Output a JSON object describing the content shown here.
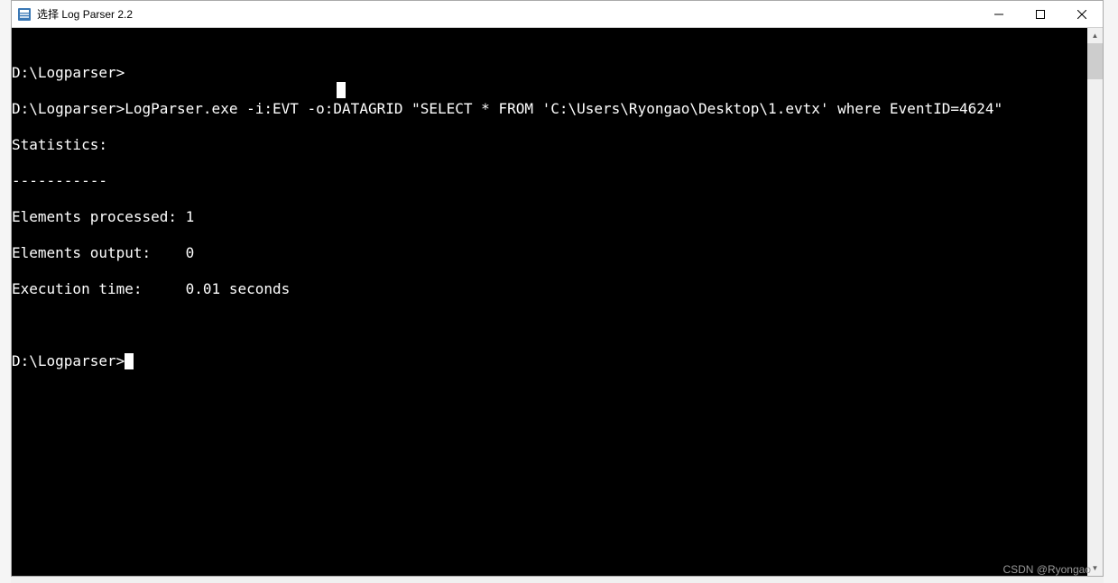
{
  "window": {
    "title": "选择 Log Parser 2.2"
  },
  "terminal": {
    "lines": [
      "",
      "D:\\Logparser>",
      "D:\\Logparser>LogParser.exe -i:EVT -o:DATAGRID \"SELECT * FROM 'C:\\Users\\Ryongao\\Desktop\\1.evtx' where EventID=4624\"",
      "",
      "Statistics:",
      "-----------",
      "Elements processed: 1",
      "Elements output:    0",
      "Execution time:     0.01 seconds",
      "",
      "",
      "D:\\Logparser>"
    ],
    "prompt": "D:\\Logparser>",
    "command": "LogParser.exe -i:EVT -o:DATAGRID \"SELECT * FROM 'C:\\Users\\Ryongao\\Desktop\\1.evtx' where EventID=4624\"",
    "stats": {
      "header": "Statistics:",
      "separator": "-----------",
      "elements_processed_label": "Elements processed:",
      "elements_processed_value": "1",
      "elements_output_label": "Elements output:",
      "elements_output_value": "0",
      "execution_time_label": "Execution time:",
      "execution_time_value": "0.01 seconds"
    }
  },
  "watermark": "CSDN @Ryongao"
}
